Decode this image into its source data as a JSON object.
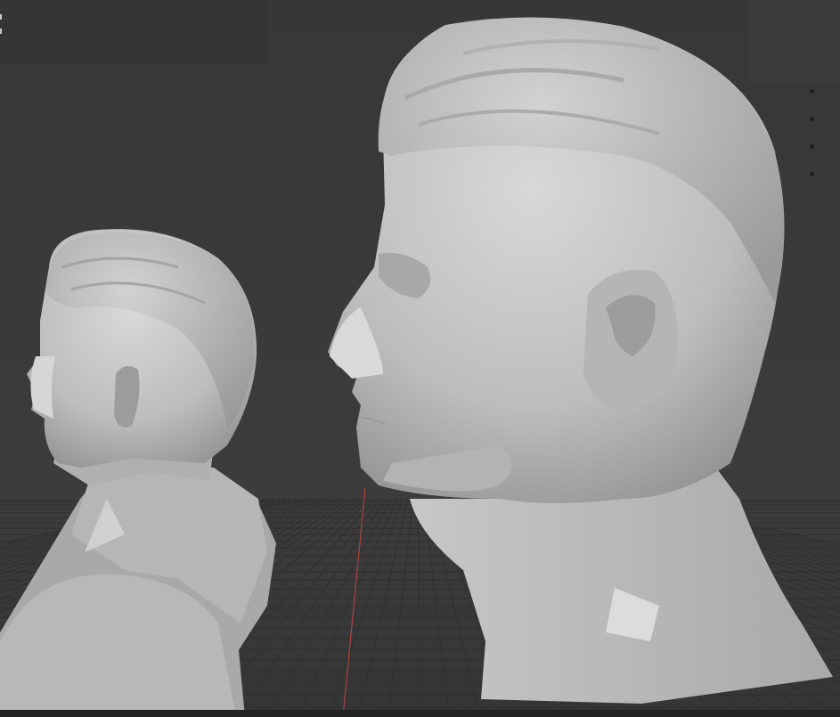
{
  "app": {
    "name": "",
    "view": "3D Viewport"
  },
  "viewport": {
    "background_color": "#393939",
    "grid_color": "#2f2f2f",
    "x_axis_color": "#c0443e",
    "mesh_color": "#c9c9c9",
    "objects": [
      {
        "label": "",
        "kind": "bust-sculpt-small",
        "icon": "sculpt-mesh-icon"
      },
      {
        "label": "",
        "kind": "head-sculpt-large",
        "icon": "sculpt-mesh-icon"
      }
    ]
  }
}
